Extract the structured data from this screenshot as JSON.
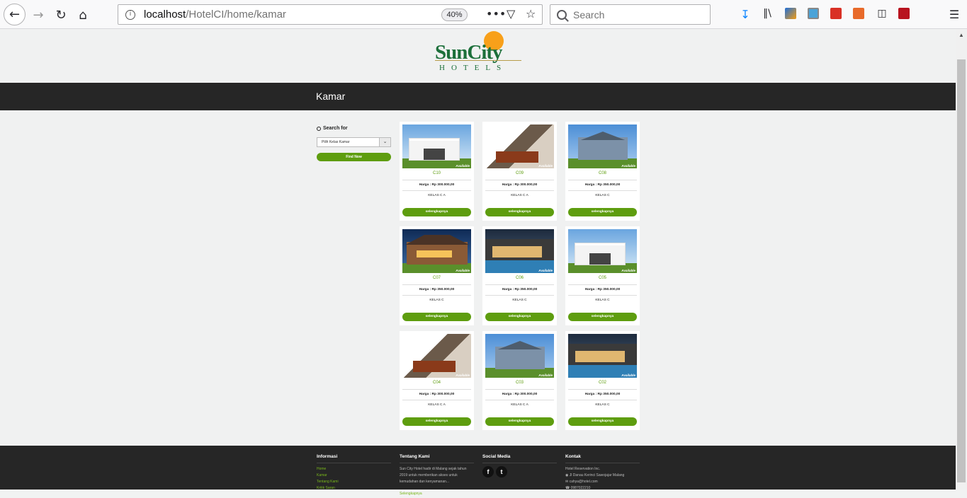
{
  "browser": {
    "url_host": "localhost",
    "url_path": "/HotelCI/home/kamar",
    "zoom": "40%",
    "search_placeholder": "Search"
  },
  "logo": {
    "name_part1": "Sun",
    "name_part2": "City",
    "sub": "HOTELS"
  },
  "page_title": "Kamar",
  "sidebar": {
    "search_label": "Search for",
    "select_value": "Pilih Kelas Kamar",
    "find_button": "Find Now"
  },
  "rooms": [
    {
      "code": "C10",
      "price": "Harga : Rp 300.000,00",
      "kelas": "KELAS C A",
      "status": "Available",
      "button": "selengkapnya",
      "style": "modern-white"
    },
    {
      "code": "C09",
      "price": "Harga : Rp 300.000,00",
      "kelas": "KELAS C A",
      "status": "Available",
      "button": "selengkapnya",
      "style": "interior"
    },
    {
      "code": "C08",
      "price": "Harga : Rp 350.000,00",
      "kelas": "KELAS C",
      "status": "Available",
      "button": "selengkapnya",
      "style": "blue-house"
    },
    {
      "code": "C07",
      "price": "Harga : Rp 350.000,00",
      "kelas": "KELAS C",
      "status": "Available",
      "button": "selengkapnya",
      "style": "night-house"
    },
    {
      "code": "C06",
      "price": "Harga : Rp 350.000,00",
      "kelas": "KELAS C",
      "status": "Available",
      "button": "selengkapnya",
      "style": "pool-night"
    },
    {
      "code": "C05",
      "price": "Harga : Rp 350.000,00",
      "kelas": "KELAS C",
      "status": "Available",
      "button": "selengkapnya",
      "style": "modern-white"
    },
    {
      "code": "C04",
      "price": "Harga : Rp 300.000,00",
      "kelas": "KELAS C A",
      "status": "Available",
      "button": "selengkapnya",
      "style": "interior"
    },
    {
      "code": "C03",
      "price": "Harga : Rp 300.000,00",
      "kelas": "KELAS C A",
      "status": "Available",
      "button": "selengkapnya",
      "style": "blue-house"
    },
    {
      "code": "C02",
      "price": "Harga : Rp 350.000,00",
      "kelas": "KELAS C",
      "status": "Available",
      "button": "selengkapnya",
      "style": "pool-night"
    }
  ],
  "footer": {
    "informasi": {
      "title": "Informasi",
      "links": [
        "Home",
        "Kamar",
        "Tentang Kami",
        "Kritik Saran"
      ]
    },
    "tentang": {
      "title": "Tentang Kami",
      "text": [
        "Sun City Hotel hadir di Malang sejak tahun",
        "2019 untuk memberikan akses untuk",
        "kemudahan dan kenyamanan..."
      ],
      "more": "Selengkapnya"
    },
    "social": {
      "title": "Social Media",
      "icons": [
        "facebook-icon",
        "twitter-icon"
      ]
    },
    "kontak": {
      "title": "Kontak",
      "lines": [
        "Hotel Reservation Inc.",
        "Jl Danau Kerinci Sawojajar Malang",
        "cahya@hotel.com",
        "0987022210"
      ]
    }
  },
  "colors": {
    "accent": "#5e9d0f",
    "banner": "#262626",
    "logo_green": "#1c6f3a",
    "sun": "#f8a01a"
  }
}
